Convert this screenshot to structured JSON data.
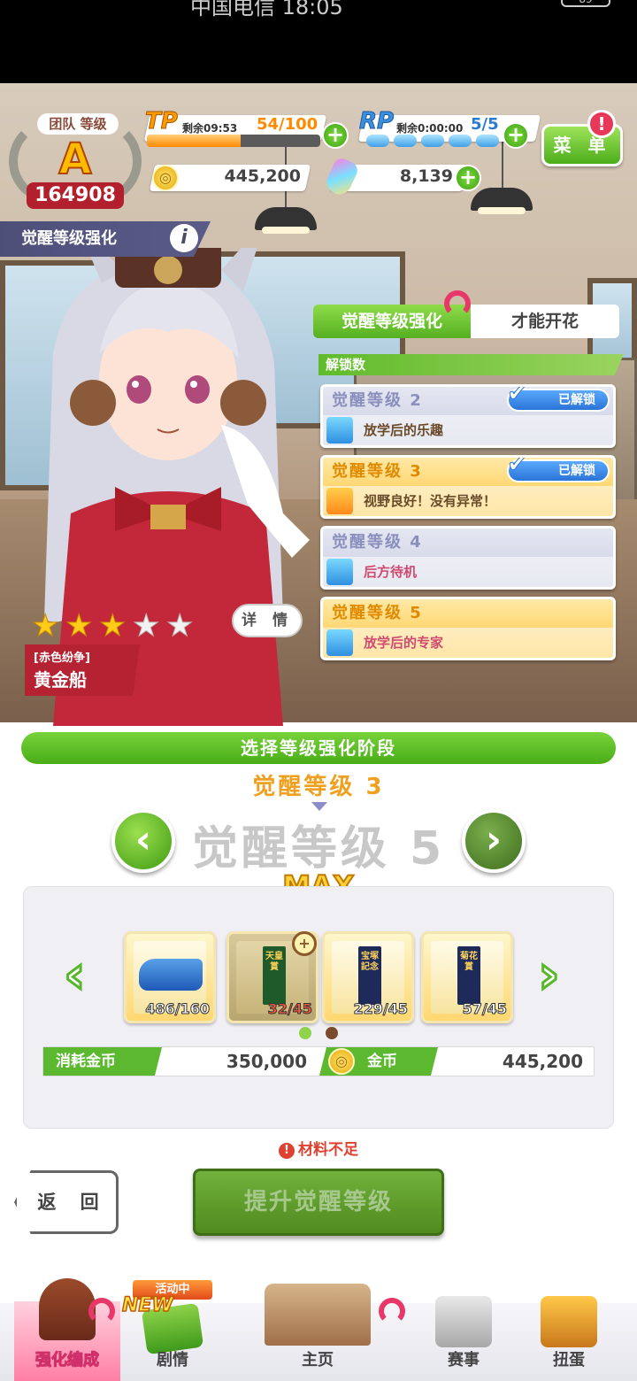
{
  "status_bar": {
    "carrier": "中国电信 18:05",
    "battery": "89"
  },
  "hud": {
    "rank_label": "团队 等级",
    "rank_grade": "A",
    "rank_score": "164908",
    "tp_label": "TP",
    "tp_timer": "剩余09:53",
    "tp_value": "54/100",
    "tp_fill": 0.54,
    "rp_label": "RP",
    "rp_timer": "剩余0:00:00",
    "rp_value": "5/5",
    "coins": "445,200",
    "carrots": "8,139",
    "menu_label": "菜 单",
    "menu_alert": "!"
  },
  "page_title": "觉醒等级强化",
  "info_icon": "i",
  "character": {
    "stars_filled": 3,
    "stars_total": 5,
    "detail_label": "详 情",
    "epithet": "[赤色纷争]",
    "name": "黄金船"
  },
  "tabs": {
    "awakening": "觉醒等级强化",
    "talent": "才能开花"
  },
  "unlock_header": "解锁数",
  "levels": [
    {
      "title": "觉醒等级 2",
      "skill": "放学后的乐趣",
      "unlocked": true,
      "badge": "已解锁",
      "style": "grey"
    },
    {
      "title": "觉醒等级 3",
      "skill": "视野良好！没有异常！",
      "unlocked": true,
      "badge": "已解锁",
      "style": "gold"
    },
    {
      "title": "觉醒等级 4",
      "skill": "后方待机",
      "unlocked": false,
      "badge": "",
      "style": "grey"
    },
    {
      "title": "觉醒等级 5",
      "skill": "放学后的专家",
      "unlocked": false,
      "badge": "",
      "style": "gold"
    }
  ],
  "select": {
    "bar_label": "选择等级强化阶段",
    "current_level": "觉醒等级 3",
    "target_level": "觉醒等级 5",
    "max_label": "MAX"
  },
  "materials": [
    {
      "name": "shoes",
      "count": "486/160",
      "sufficient": true
    },
    {
      "name": "tennoushou-banner",
      "banner_text": "天皇賞",
      "count": "32/45",
      "sufficient": false
    },
    {
      "name": "takarazuka-banner",
      "banner_text": "宝塚記念",
      "count": "229/45",
      "sufficient": true
    },
    {
      "name": "kikkashou-banner",
      "banner_text": "菊花賞",
      "count": "57/45",
      "sufficient": true
    }
  ],
  "cost": {
    "cost_label": "消耗金币",
    "cost_value": "350,000",
    "coin_label": "金币",
    "coin_value": "445,200"
  },
  "warning": "材料不足",
  "buttons": {
    "back": "返 回",
    "upgrade": "提升觉醒等级"
  },
  "bottom_nav": {
    "items": [
      {
        "label": "强化编成",
        "selected": true
      },
      {
        "label": "剧情",
        "selected": false
      },
      {
        "label": "主页",
        "selected": false
      },
      {
        "label": "赛事",
        "selected": false
      },
      {
        "label": "扭蛋",
        "selected": false
      }
    ],
    "event_badge": "活动中",
    "new_badge": "NEW"
  }
}
